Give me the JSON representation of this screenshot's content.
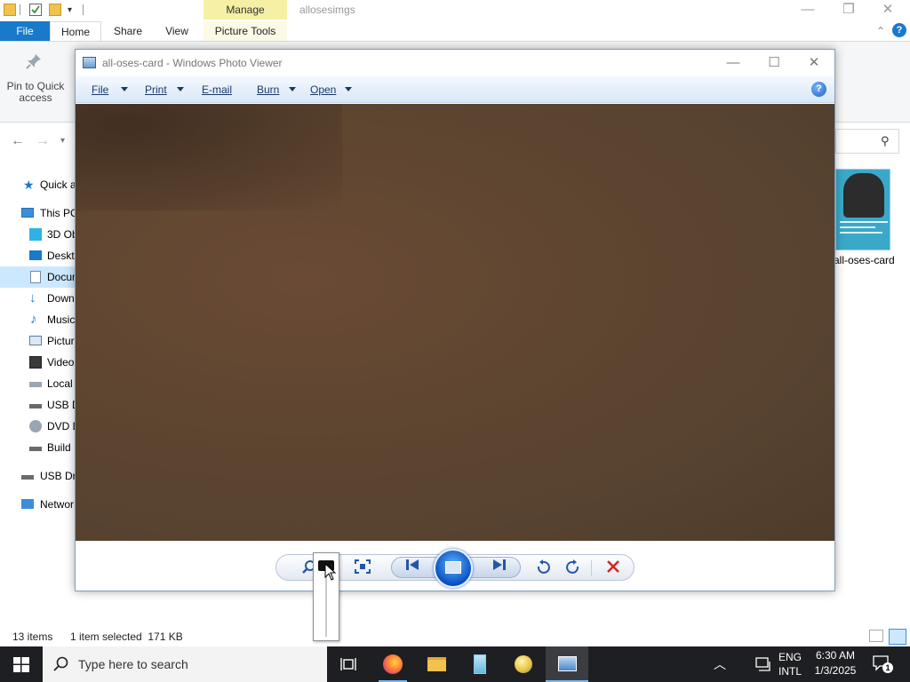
{
  "explorer": {
    "window_title": "allosesimgs",
    "ribbon_context_tab": "Manage",
    "tabs": [
      "File",
      "Home",
      "Share",
      "View",
      "Picture Tools"
    ],
    "pin_label": "Pin to Quick access",
    "nav": [
      "Quick a",
      "This PC",
      "3D Ob",
      "Deskto",
      "Docum",
      "Down",
      "Music",
      "Pictur",
      "Videos",
      "Local",
      "USB D",
      "DVD D",
      "Build",
      "USB Dri",
      "Networ"
    ],
    "selected_nav": "Docum",
    "thumbnail_label": "all-oses-card",
    "status": {
      "items": "13 items",
      "selection": "1 item selected  171 KB"
    }
  },
  "viewer": {
    "title": "all-oses-card - Windows Photo Viewer",
    "menu": [
      "File",
      "Print",
      "E-mail",
      "Burn",
      "Open"
    ],
    "help": "?",
    "controls": {
      "zoom": "zoom-icon",
      "actual_size": "fit-window-icon",
      "previous": "previous-icon",
      "slideshow": "slideshow-icon",
      "next": "next-icon",
      "rotate_ccw": "rotate-ccw-icon",
      "rotate_cw": "rotate-cw-icon",
      "delete": "delete-icon"
    },
    "accent": "#0a4fc0"
  },
  "taskbar": {
    "search_placeholder": "Type here to search",
    "lang_top": "ENG",
    "lang_bottom": "INTL",
    "time": "6:30 AM",
    "date": "1/3/2025",
    "notifications": "1"
  }
}
